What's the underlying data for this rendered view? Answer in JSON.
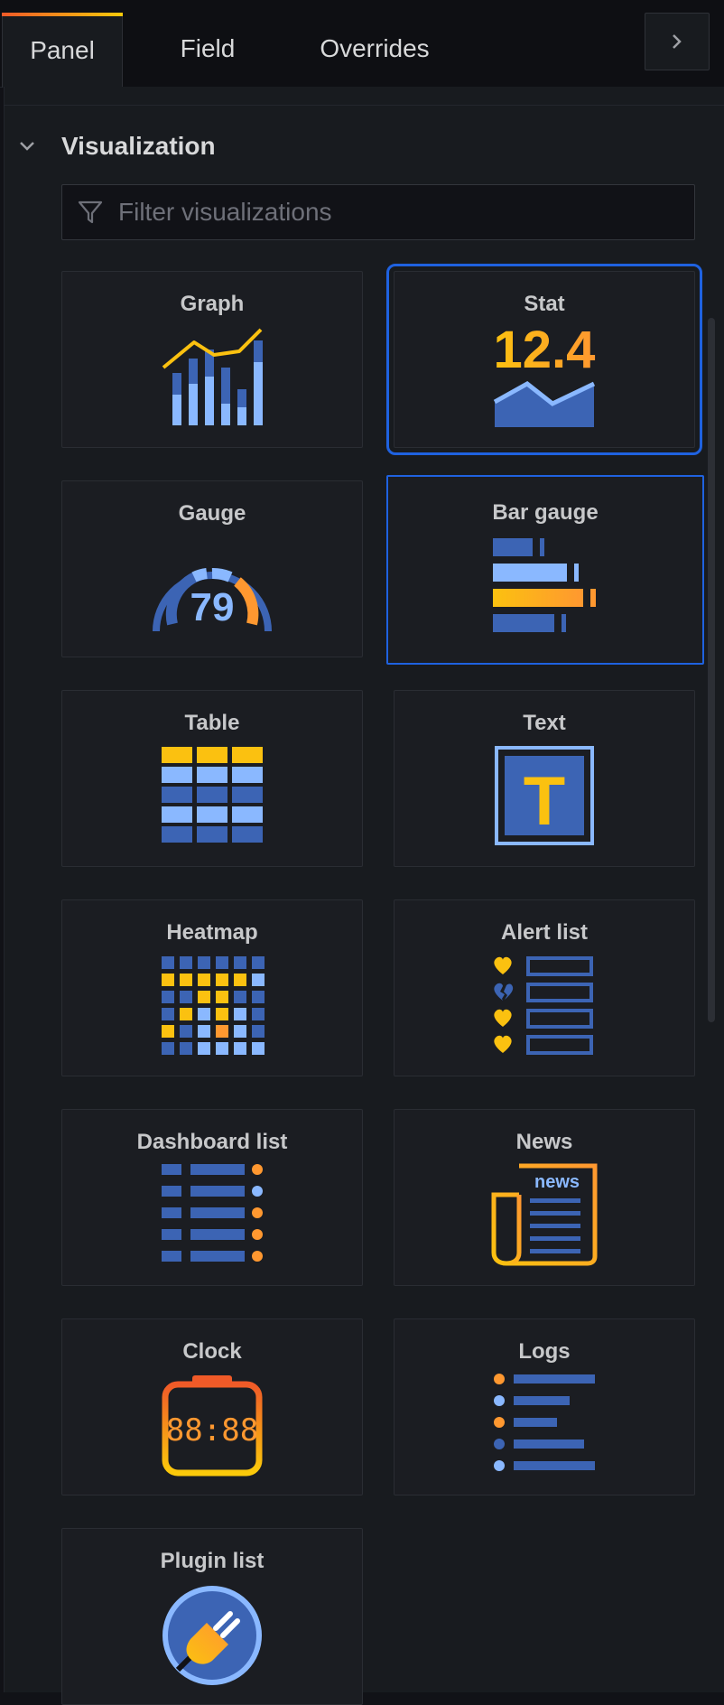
{
  "tabs": [
    {
      "label": "Panel",
      "active": true
    },
    {
      "label": "Field",
      "active": false
    },
    {
      "label": "Overrides",
      "active": false
    }
  ],
  "section": {
    "title": "Visualization",
    "expanded": true
  },
  "filter": {
    "placeholder": "Filter visualizations",
    "value": ""
  },
  "visualizations": [
    {
      "label": "Graph",
      "icon": "graph-icon"
    },
    {
      "label": "Stat",
      "icon": "stat-icon",
      "value_text": "12.4",
      "state": "selected"
    },
    {
      "label": "Gauge",
      "icon": "gauge-icon",
      "value_text": "79"
    },
    {
      "label": "Bar gauge",
      "icon": "bar-gauge-icon",
      "state": "hover"
    },
    {
      "label": "Table",
      "icon": "table-icon"
    },
    {
      "label": "Text",
      "icon": "text-icon",
      "glyph": "T"
    },
    {
      "label": "Heatmap",
      "icon": "heatmap-icon"
    },
    {
      "label": "Alert list",
      "icon": "alert-list-icon"
    },
    {
      "label": "Dashboard list",
      "icon": "dashboard-list-icon"
    },
    {
      "label": "News",
      "icon": "news-icon",
      "glyph": "news"
    },
    {
      "label": "Clock",
      "icon": "clock-icon",
      "glyph": "88:88"
    },
    {
      "label": "Logs",
      "icon": "logs-icon"
    },
    {
      "label": "Plugin list",
      "icon": "plugin-list-icon"
    }
  ],
  "colors": {
    "accent_blue": "#1f62e0",
    "series_blue": "#3c64b4",
    "light_blue": "#8ab8ff",
    "yellow": "#fbc110",
    "orange": "#ff9830"
  }
}
